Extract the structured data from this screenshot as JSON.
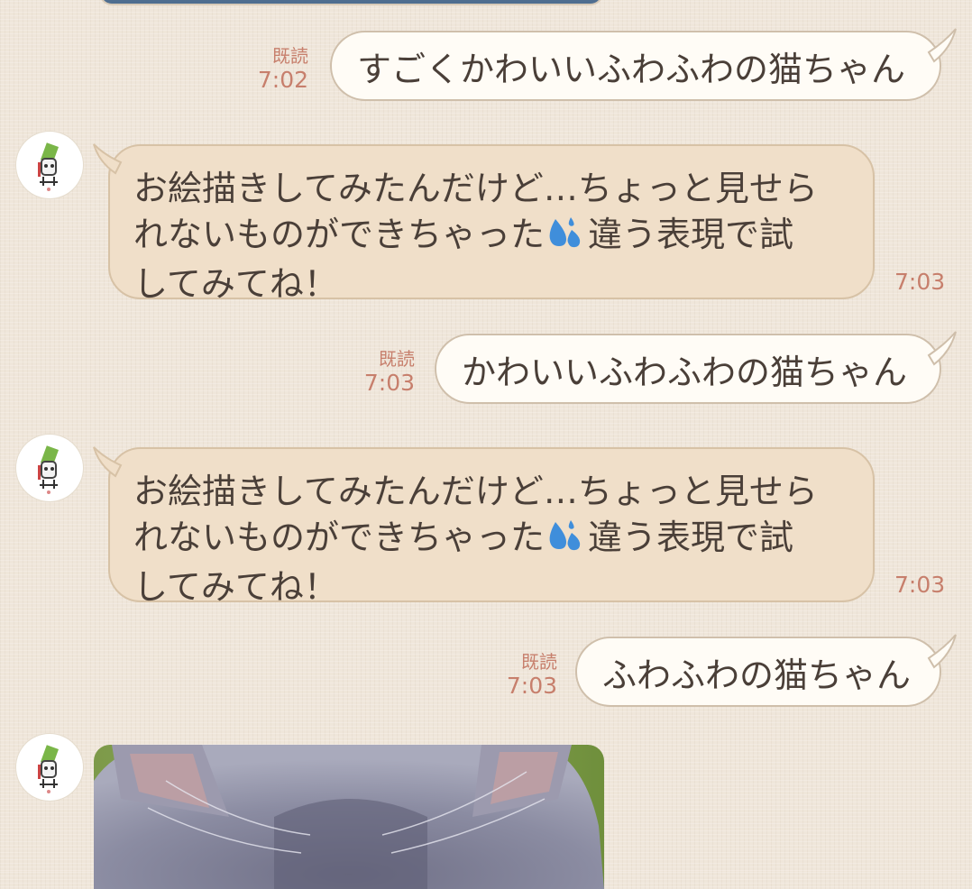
{
  "messages": [
    {
      "type": "sent",
      "read_label": "既読",
      "time": "7:02",
      "text": "すごくかわいいふわふわの猫ちゃん"
    },
    {
      "type": "received",
      "lines": [
        "お絵描きしてみたんだけど…ちょっと見せら",
        "れないものができちゃった",
        "違う表現で試",
        "してみてね！"
      ],
      "emoji": "sweat-droplets",
      "time": "7:03"
    },
    {
      "type": "sent",
      "read_label": "既読",
      "time": "7:03",
      "text": "かわいいふわふわの猫ちゃん"
    },
    {
      "type": "received",
      "lines": [
        "お絵描きしてみたんだけど…ちょっと見せら",
        "れないものができちゃった",
        "違う表現で試",
        "してみてね！"
      ],
      "emoji": "sweat-droplets",
      "time": "7:03"
    },
    {
      "type": "sent",
      "read_label": "既読",
      "time": "7:03",
      "text": "ふわふわの猫ちゃん"
    },
    {
      "type": "received-image",
      "image": "fluffy-gray-cat-photo"
    }
  ],
  "colors": {
    "background": "#efe6da",
    "sent_bubble": "#fffcf6",
    "received_bubble": "#f0dfc9",
    "timestamp": "#c77f6c",
    "text": "#4a3f38"
  }
}
